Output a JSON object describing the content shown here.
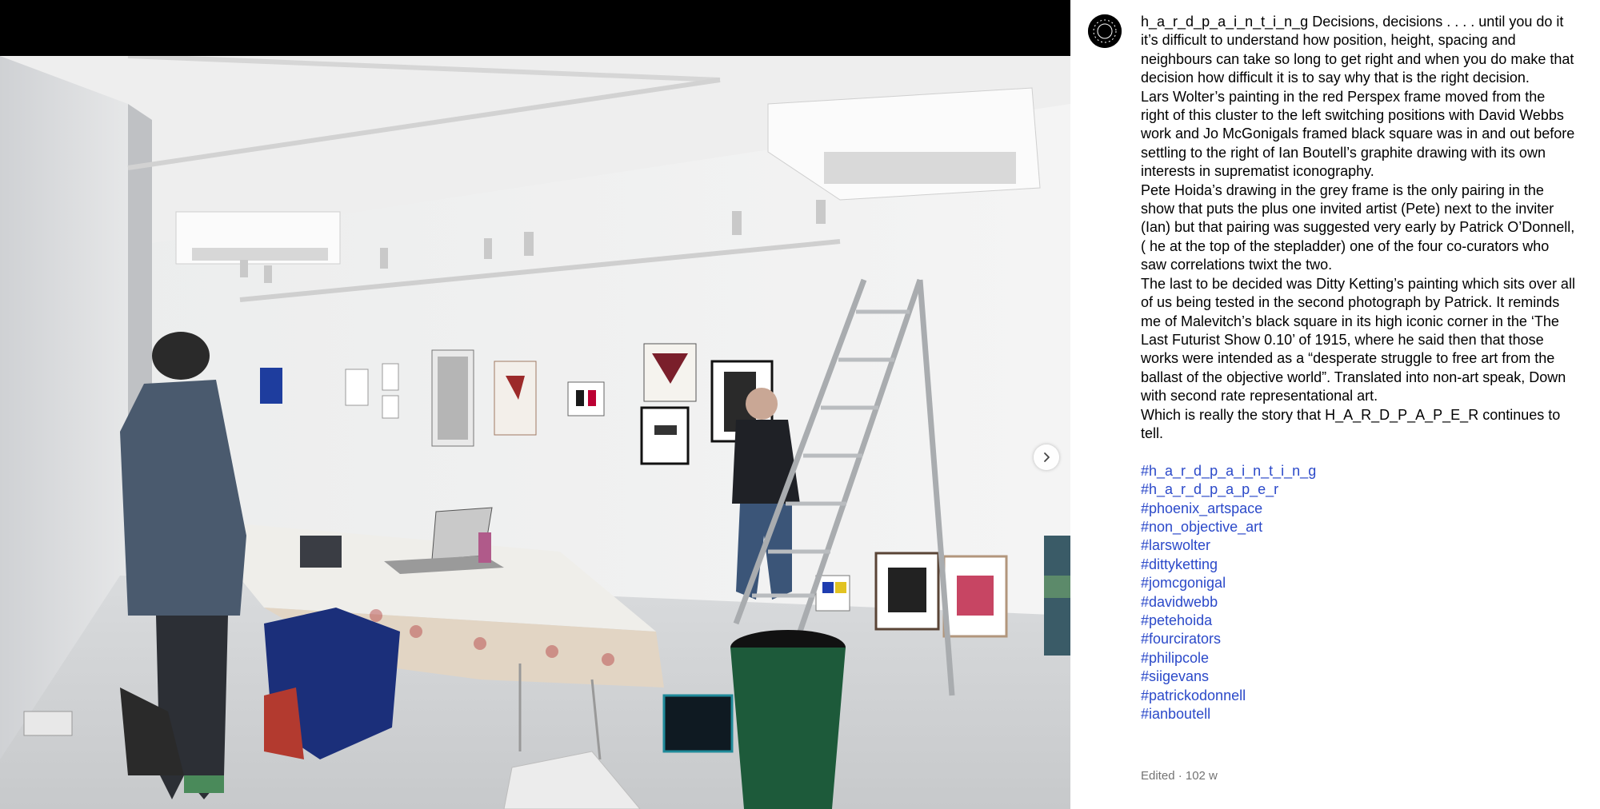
{
  "post": {
    "username": "h_a_r_d_p_a_i_n_t_i_n_g",
    "paragraphs": [
      "Decisions, decisions . . . . until you do it it’s difficult to understand how position, height, spacing and neighbours can take so long to get right and when you do make that decision how difficult it is to say why that is the right decision.",
      "Lars Wolter’s painting in the red Perspex frame moved from the right of this cluster to the left switching positions with David Webbs work and Jo McGonigals framed black square was in and out before settling to the right of Ian Boutell’s graphite drawing with its own interests in suprematist iconography.",
      "Pete Hoida’s drawing in the grey frame is the only pairing in the show that puts the plus one invited artist (Pete) next to the inviter (Ian) but that pairing was suggested very early by Patrick O’Donnell,( he at the top of the stepladder) one of the four co-curators who saw correlations twixt the two.",
      "The last to be decided was Ditty Ketting’s painting which sits over all of us being tested in the second photograph by Patrick. It reminds me of Malevitch’s black square in its high iconic corner in the ‘The Last Futurist Show 0.10’ of 1915, where he said then that those works were intended as a “desperate struggle to free art from the ballast of the objective world”. Translated into non-art speak, Down with second rate representational art.",
      "Which is really the story that H_A_R_D_P_A_P_E_R continues to tell."
    ],
    "hashtags": [
      "#h_a_r_d_p_a_i_n_t_i_n_g",
      "#h_a_r_d_p_a_p_e_r",
      "#phoenix_artspace",
      "#non_objective_art",
      "#larswolter",
      "#dittyketting",
      "#jomcgonigal",
      "#davidwebb",
      "#petehoida",
      "#fourcirators",
      "#philipcole",
      "#siigevans",
      "#patrickodonnell",
      "#ianboutell"
    ],
    "meta": "Edited · 102 w"
  },
  "media": {
    "next_icon": "chevron-right-icon",
    "avatar_icon": "profile-avatar-icon"
  },
  "colors": {
    "hashtag": "#2b49c9",
    "meta": "#737373",
    "media_bg": "#000000"
  }
}
